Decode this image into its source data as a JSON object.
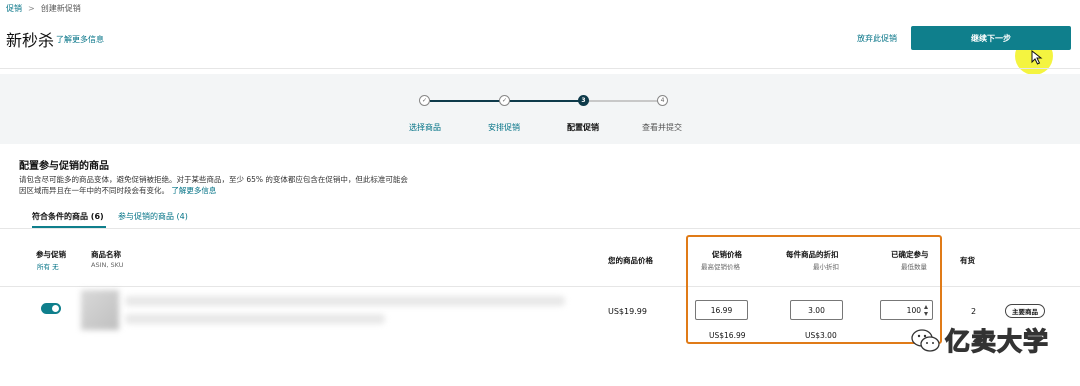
{
  "breadcrumb": {
    "root": "促销",
    "separator": ">",
    "current": "创建新促销"
  },
  "header": {
    "title": "新秒杀",
    "learn_more": "了解更多信息",
    "abandon": "放弃此促销",
    "continue": "继续下一步"
  },
  "stepper": {
    "steps": [
      {
        "num": "✓",
        "label": "选择商品"
      },
      {
        "num": "✓",
        "label": "安排促销"
      },
      {
        "num": "3",
        "label": "配置促销"
      },
      {
        "num": "4",
        "label": "查看并提交"
      }
    ]
  },
  "section": {
    "title": "配置参与促销的商品",
    "desc_line1": "请包含尽可能多的商品变体，避免促销被拒绝。对于某些商品，至少 65% 的变体都应包含在促销中，但此标准可能会",
    "desc_line2": "因区域而异且在一年中的不同时段会有变化。",
    "desc_link": "了解更多信息"
  },
  "tabs": {
    "eligible": "符合条件的商品 (6)",
    "participating": "参与促销的商品 (4)"
  },
  "table": {
    "col_participate": "参与促销",
    "col_participate_all": "所有",
    "col_participate_none": "无",
    "col_name": "商品名称",
    "col_name_sub": "ASIN, SKU",
    "col_your_price": "您的商品价格",
    "col_promo_price": "促销价格",
    "col_promo_price_sub": "最高促销价格",
    "col_discount": "每件商品的折扣",
    "col_discount_sub": "最小折扣",
    "col_committed": "已确定参与",
    "col_committed_sub": "最低数量",
    "col_stock": "有货"
  },
  "row": {
    "your_price": "US$19.99",
    "promo_price_value": "16.99",
    "promo_price_max": "US$16.99",
    "discount_value": "3.00",
    "discount_min": "US$3.00",
    "qty_value": "100",
    "stock": "2",
    "badge": "主要商品"
  },
  "watermark": {
    "text": "亿卖大学"
  },
  "colors": {
    "accent": "#0f7f8c",
    "highlight": "#e07b18",
    "link": "#007185"
  }
}
